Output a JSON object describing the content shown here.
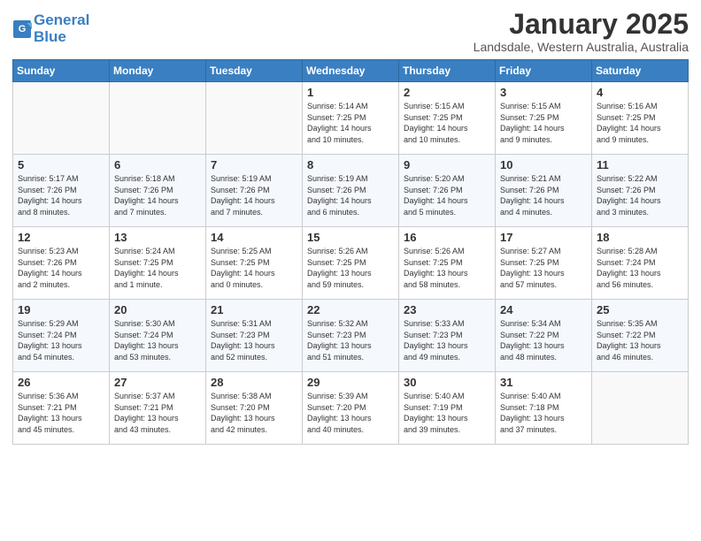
{
  "logo": {
    "line1": "General",
    "line2": "Blue"
  },
  "header": {
    "month": "January 2025",
    "location": "Landsdale, Western Australia, Australia"
  },
  "weekdays": [
    "Sunday",
    "Monday",
    "Tuesday",
    "Wednesday",
    "Thursday",
    "Friday",
    "Saturday"
  ],
  "weeks": [
    [
      {
        "day": "",
        "info": ""
      },
      {
        "day": "",
        "info": ""
      },
      {
        "day": "",
        "info": ""
      },
      {
        "day": "1",
        "info": "Sunrise: 5:14 AM\nSunset: 7:25 PM\nDaylight: 14 hours\nand 10 minutes."
      },
      {
        "day": "2",
        "info": "Sunrise: 5:15 AM\nSunset: 7:25 PM\nDaylight: 14 hours\nand 10 minutes."
      },
      {
        "day": "3",
        "info": "Sunrise: 5:15 AM\nSunset: 7:25 PM\nDaylight: 14 hours\nand 9 minutes."
      },
      {
        "day": "4",
        "info": "Sunrise: 5:16 AM\nSunset: 7:25 PM\nDaylight: 14 hours\nand 9 minutes."
      }
    ],
    [
      {
        "day": "5",
        "info": "Sunrise: 5:17 AM\nSunset: 7:26 PM\nDaylight: 14 hours\nand 8 minutes."
      },
      {
        "day": "6",
        "info": "Sunrise: 5:18 AM\nSunset: 7:26 PM\nDaylight: 14 hours\nand 7 minutes."
      },
      {
        "day": "7",
        "info": "Sunrise: 5:19 AM\nSunset: 7:26 PM\nDaylight: 14 hours\nand 7 minutes."
      },
      {
        "day": "8",
        "info": "Sunrise: 5:19 AM\nSunset: 7:26 PM\nDaylight: 14 hours\nand 6 minutes."
      },
      {
        "day": "9",
        "info": "Sunrise: 5:20 AM\nSunset: 7:26 PM\nDaylight: 14 hours\nand 5 minutes."
      },
      {
        "day": "10",
        "info": "Sunrise: 5:21 AM\nSunset: 7:26 PM\nDaylight: 14 hours\nand 4 minutes."
      },
      {
        "day": "11",
        "info": "Sunrise: 5:22 AM\nSunset: 7:26 PM\nDaylight: 14 hours\nand 3 minutes."
      }
    ],
    [
      {
        "day": "12",
        "info": "Sunrise: 5:23 AM\nSunset: 7:26 PM\nDaylight: 14 hours\nand 2 minutes."
      },
      {
        "day": "13",
        "info": "Sunrise: 5:24 AM\nSunset: 7:25 PM\nDaylight: 14 hours\nand 1 minute."
      },
      {
        "day": "14",
        "info": "Sunrise: 5:25 AM\nSunset: 7:25 PM\nDaylight: 14 hours\nand 0 minutes."
      },
      {
        "day": "15",
        "info": "Sunrise: 5:26 AM\nSunset: 7:25 PM\nDaylight: 13 hours\nand 59 minutes."
      },
      {
        "day": "16",
        "info": "Sunrise: 5:26 AM\nSunset: 7:25 PM\nDaylight: 13 hours\nand 58 minutes."
      },
      {
        "day": "17",
        "info": "Sunrise: 5:27 AM\nSunset: 7:25 PM\nDaylight: 13 hours\nand 57 minutes."
      },
      {
        "day": "18",
        "info": "Sunrise: 5:28 AM\nSunset: 7:24 PM\nDaylight: 13 hours\nand 56 minutes."
      }
    ],
    [
      {
        "day": "19",
        "info": "Sunrise: 5:29 AM\nSunset: 7:24 PM\nDaylight: 13 hours\nand 54 minutes."
      },
      {
        "day": "20",
        "info": "Sunrise: 5:30 AM\nSunset: 7:24 PM\nDaylight: 13 hours\nand 53 minutes."
      },
      {
        "day": "21",
        "info": "Sunrise: 5:31 AM\nSunset: 7:23 PM\nDaylight: 13 hours\nand 52 minutes."
      },
      {
        "day": "22",
        "info": "Sunrise: 5:32 AM\nSunset: 7:23 PM\nDaylight: 13 hours\nand 51 minutes."
      },
      {
        "day": "23",
        "info": "Sunrise: 5:33 AM\nSunset: 7:23 PM\nDaylight: 13 hours\nand 49 minutes."
      },
      {
        "day": "24",
        "info": "Sunrise: 5:34 AM\nSunset: 7:22 PM\nDaylight: 13 hours\nand 48 minutes."
      },
      {
        "day": "25",
        "info": "Sunrise: 5:35 AM\nSunset: 7:22 PM\nDaylight: 13 hours\nand 46 minutes."
      }
    ],
    [
      {
        "day": "26",
        "info": "Sunrise: 5:36 AM\nSunset: 7:21 PM\nDaylight: 13 hours\nand 45 minutes."
      },
      {
        "day": "27",
        "info": "Sunrise: 5:37 AM\nSunset: 7:21 PM\nDaylight: 13 hours\nand 43 minutes."
      },
      {
        "day": "28",
        "info": "Sunrise: 5:38 AM\nSunset: 7:20 PM\nDaylight: 13 hours\nand 42 minutes."
      },
      {
        "day": "29",
        "info": "Sunrise: 5:39 AM\nSunset: 7:20 PM\nDaylight: 13 hours\nand 40 minutes."
      },
      {
        "day": "30",
        "info": "Sunrise: 5:40 AM\nSunset: 7:19 PM\nDaylight: 13 hours\nand 39 minutes."
      },
      {
        "day": "31",
        "info": "Sunrise: 5:40 AM\nSunset: 7:18 PM\nDaylight: 13 hours\nand 37 minutes."
      },
      {
        "day": "",
        "info": ""
      }
    ]
  ]
}
